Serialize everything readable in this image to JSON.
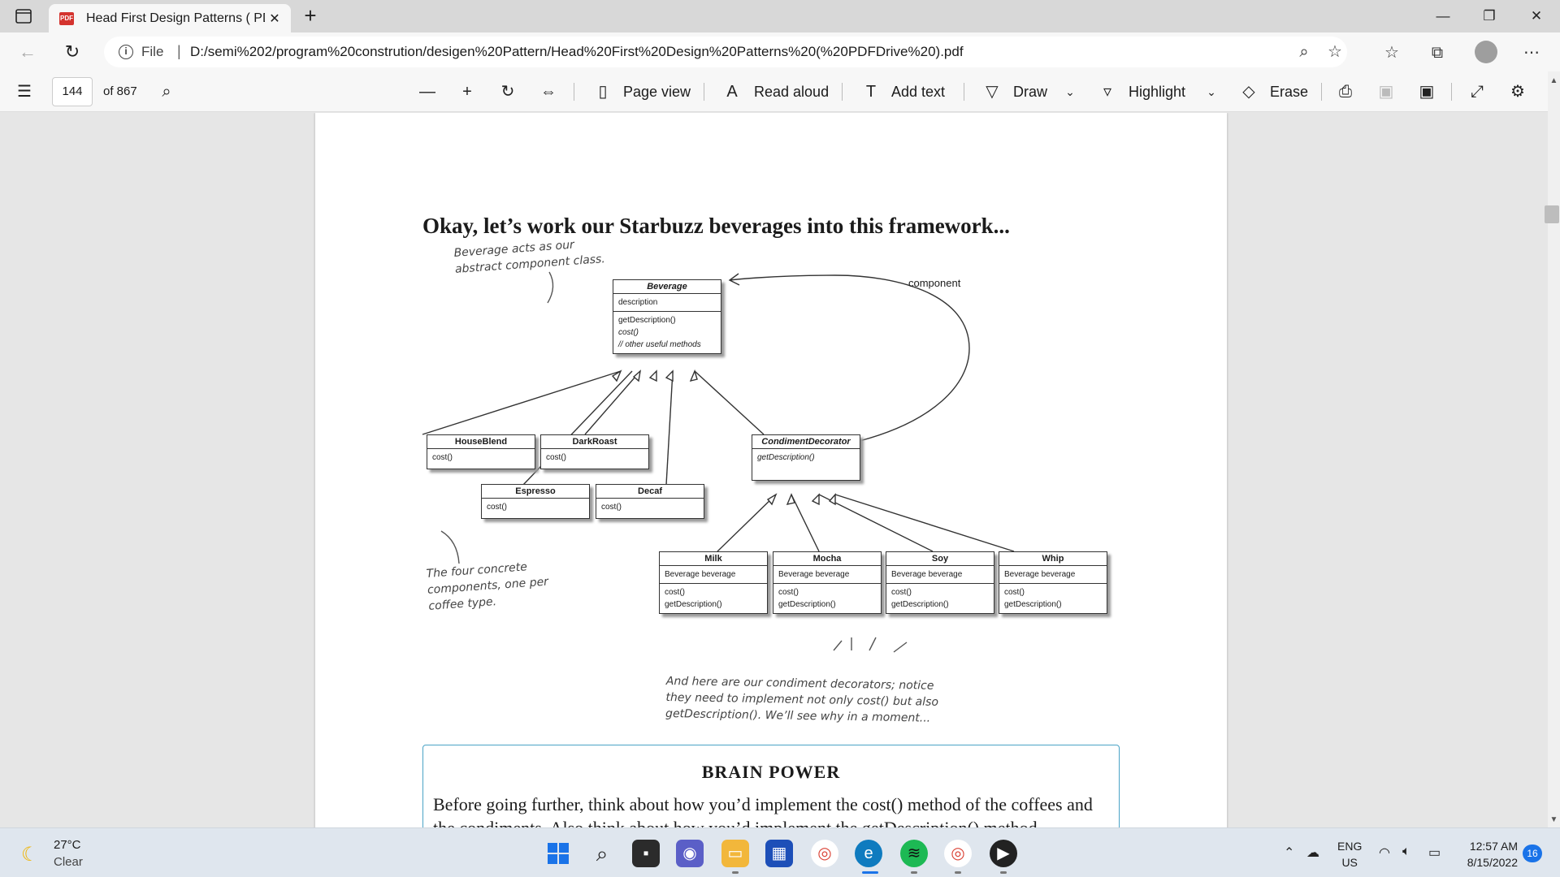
{
  "browser": {
    "tab": {
      "title": "Head First Design Patterns ( PDF",
      "favicon": "PDF",
      "close": "✕"
    },
    "url": {
      "scheme_label": "File",
      "address": "D:/semi%202/program%20constrution/desigen%20Pattern/Head%20First%20Design%20Patterns%20(%20PDFDrive%20).pdf"
    }
  },
  "pdf_toolbar": {
    "page_number": "144",
    "page_total": "of 867",
    "page_view": "Page view",
    "read_aloud": "Read aloud",
    "add_text": "Add text",
    "draw": "Draw",
    "highlight": "Highlight",
    "erase": "Erase"
  },
  "page": {
    "heading": "Okay, let’s work our Starbuzz beverages into this framework...",
    "note_component": [
      "Beverage acts as our",
      "abstract component class."
    ],
    "note_concrete": [
      "The four concrete",
      "components, one per",
      "coffee type."
    ],
    "note_decorators": [
      "And here are our condiment decorators; notice",
      "they need to implement not only cost() but also",
      "getDescription(). We’ll see why in a moment..."
    ],
    "assoc_label": "component",
    "uml": {
      "beverage": {
        "name": "Beverage",
        "field": "description",
        "methods": [
          "getDescription()",
          "cost()",
          "// other useful methods"
        ]
      },
      "houseblend": {
        "name": "HouseBlend",
        "method": "cost()"
      },
      "darkroast": {
        "name": "DarkRoast",
        "method": "cost()"
      },
      "espresso": {
        "name": "Espresso",
        "method": "cost()"
      },
      "decaf": {
        "name": "Decaf",
        "method": "cost()"
      },
      "condiment": {
        "name": "CondimentDecorator",
        "method": "getDescription()"
      },
      "milk": {
        "name": "Milk",
        "field": "Beverage beverage",
        "m1": "cost()",
        "m2": "getDescription()"
      },
      "mocha": {
        "name": "Mocha",
        "field": "Beverage beverage",
        "m1": "cost()",
        "m2": "getDescription()"
      },
      "soy": {
        "name": "Soy",
        "field": "Beverage beverage",
        "m1": "cost()",
        "m2": "getDescription()"
      },
      "whip": {
        "name": "Whip",
        "field": "Beverage beverage",
        "m1": "cost()",
        "m2": "getDescription()"
      }
    },
    "brain_power": {
      "title": "BRAIN POWER",
      "text": "Before going further, think about how you’d implement the cost() method of the coffees and the condiments. Also think about how you’d implement the getDescription() method"
    }
  },
  "taskbar": {
    "weather": {
      "temp": "27°C",
      "desc": "Clear"
    },
    "lang": [
      "ENG",
      "US"
    ],
    "clock": {
      "time": "12:57 AM",
      "date": "8/15/2022"
    },
    "notif_count": "16"
  },
  "colors": {
    "accent": "#1a73e8",
    "brain_border": "#4aa3c6"
  }
}
